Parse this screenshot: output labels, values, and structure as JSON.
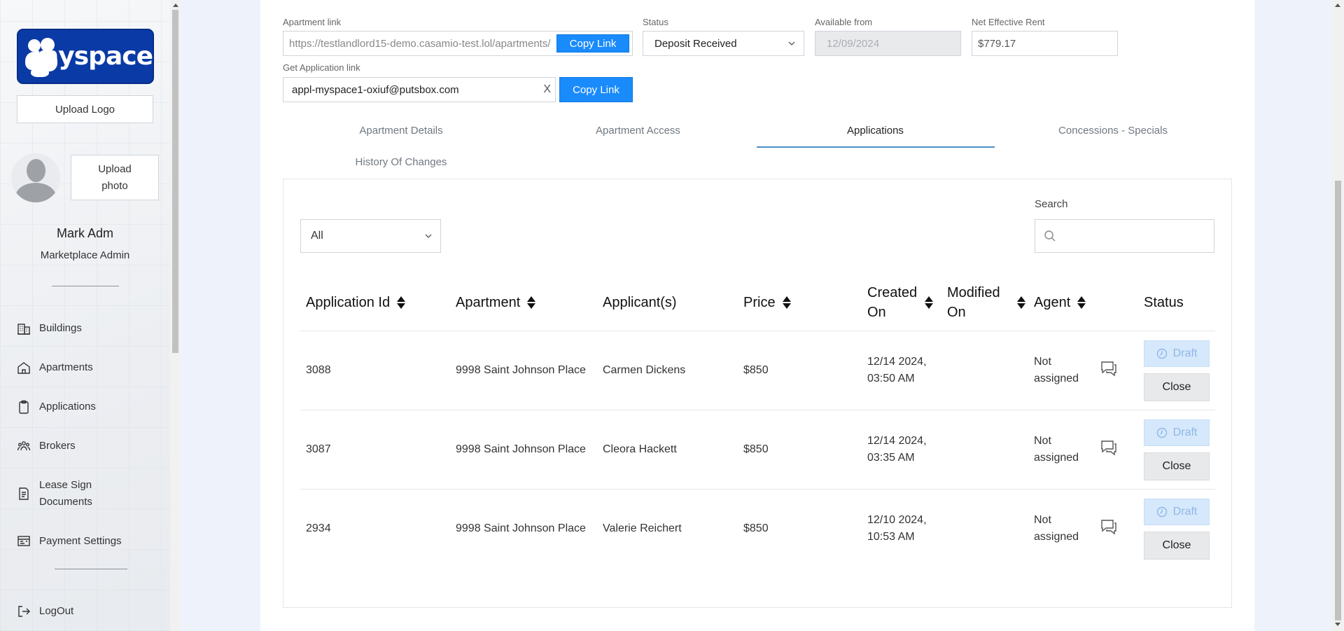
{
  "sidebar": {
    "logo_text": "myspace",
    "upload_logo": "Upload Logo",
    "upload_photo_line1": "Upload",
    "upload_photo_line2": "photo",
    "user_name": "Mark Adm",
    "user_role": "Marketplace Admin",
    "nav": [
      {
        "label": "Buildings",
        "icon": "buildings-icon"
      },
      {
        "label": "Apartments",
        "icon": "home-icon"
      },
      {
        "label": "Applications",
        "icon": "clipboard-icon"
      },
      {
        "label": "Brokers",
        "icon": "people-icon"
      },
      {
        "label": "Lease Sign Documents",
        "icon": "document-icon"
      },
      {
        "label": "Payment Settings",
        "icon": "payment-settings-icon"
      }
    ],
    "logout": "LogOut"
  },
  "form": {
    "apartment_link_label": "Apartment link",
    "apartment_link_value": "https://testlandlord15-demo.casamio-test.lol/apartments/",
    "copy_link": "Copy Link",
    "status_label": "Status",
    "status_value": "Deposit Received",
    "available_label": "Available from",
    "available_value": "12/09/2024",
    "rent_label": "Net Effective Rent",
    "rent_value": "$779.17",
    "app_link_label": "Get Application link",
    "app_link_value": "appl-myspace1-oxiuf@putsbox.com",
    "clear_x": "X",
    "copy_link2": "Copy Link"
  },
  "tabs": [
    {
      "label": "Apartment Details",
      "active": false
    },
    {
      "label": "Apartment Access",
      "active": false
    },
    {
      "label": "Applications",
      "active": true
    },
    {
      "label": "Concessions - Specials",
      "active": false
    },
    {
      "label": "History Of Changes",
      "active": false
    }
  ],
  "applications": {
    "filter_value": "All",
    "search_label": "Search",
    "search_placeholder": "",
    "columns": {
      "id": "Application Id",
      "apartment": "Apartment",
      "applicants": "Applicant(s)",
      "price": "Price",
      "created_1": "Created",
      "created_2": "On",
      "modified_1": "Modified",
      "modified_2": "On",
      "agent": "Agent",
      "status": "Status"
    },
    "rows": [
      {
        "id": "3088",
        "apartment": "9998 Saint Johnson Place",
        "applicant": "Carmen Dickens",
        "price": "$850",
        "created_date": "12/14 2024,",
        "created_time": "03:50 AM",
        "agent_1": "Not",
        "agent_2": "assigned",
        "draft": "Draft",
        "close": "Close"
      },
      {
        "id": "3087",
        "apartment": "9998 Saint Johnson Place",
        "applicant": "Cleora Hackett",
        "price": "$850",
        "created_date": "12/14 2024,",
        "created_time": "03:35 AM",
        "agent_1": "Not",
        "agent_2": "assigned",
        "draft": "Draft",
        "close": "Close"
      },
      {
        "id": "2934",
        "apartment": "9998 Saint Johnson Place",
        "applicant": "Valerie Reichert",
        "price": "$850",
        "created_date": "12/10 2024,",
        "created_time": "10:53 AM",
        "agent_1": "Not",
        "agent_2": "assigned",
        "draft": "Draft",
        "close": "Close"
      }
    ]
  },
  "colors": {
    "primary": "#1a8bfb",
    "logo_bg": "#0a3aa5",
    "draft_bg": "#d6e8fb",
    "tab_underline": "#4d8fc8"
  }
}
